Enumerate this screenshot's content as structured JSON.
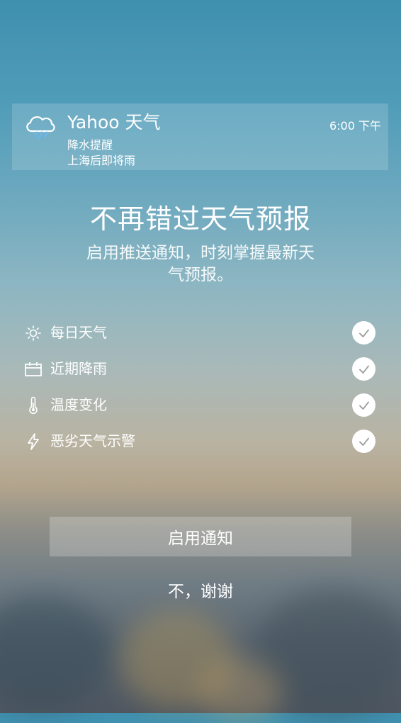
{
  "notification": {
    "app_name": "Yahoo 天气",
    "time": "6:00 下午",
    "title": "降水提醒",
    "message": "上海后即将雨",
    "icon": "cloud-rain-icon"
  },
  "heading": "不再错过天气预报",
  "subtitle": "启用推送通知，时刻掌握最新天气预报。",
  "features": [
    {
      "label": "每日天气",
      "icon": "sun-icon",
      "checked": true
    },
    {
      "label": "近期降雨",
      "icon": "calendar-icon",
      "checked": true
    },
    {
      "label": "温度变化",
      "icon": "thermometer-icon",
      "checked": true
    },
    {
      "label": "恶劣天气示警",
      "icon": "lightning-icon",
      "checked": true
    }
  ],
  "buttons": {
    "enable": "启用通知",
    "decline": "不，谢谢"
  },
  "colors": {
    "check_mark": "#9a9a9a",
    "rain_drops": "#6fb6e6"
  }
}
